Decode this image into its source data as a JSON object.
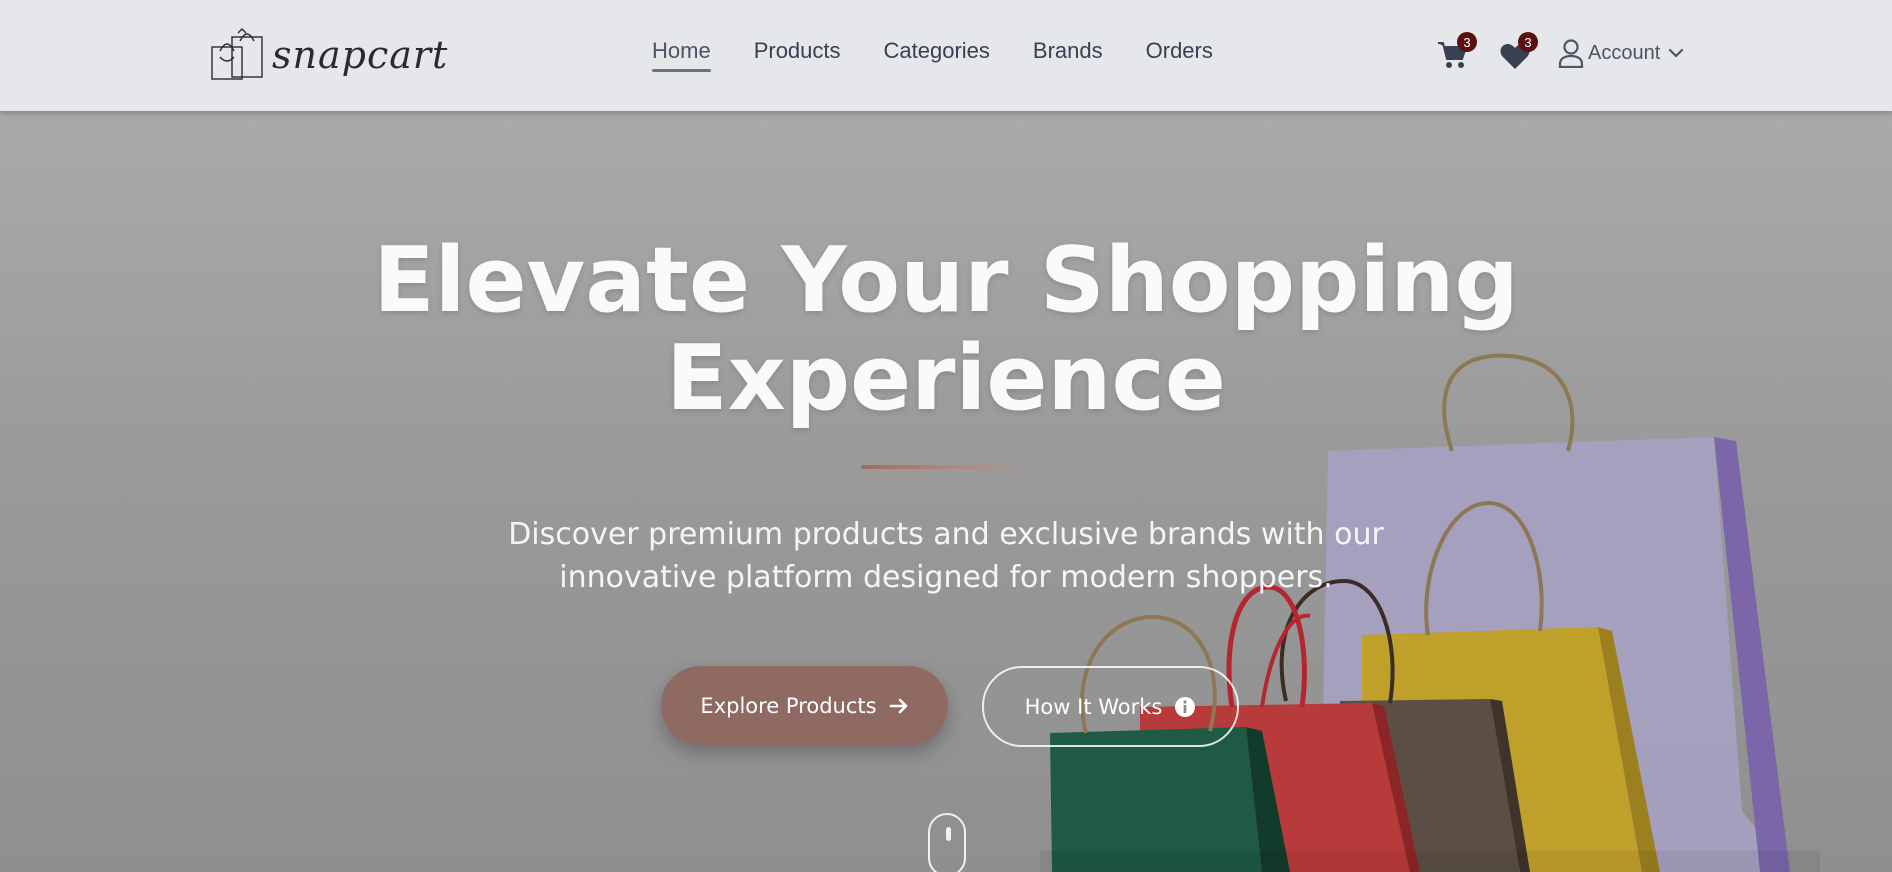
{
  "header": {
    "logo_text": "snapcart",
    "nav": [
      {
        "label": "Home",
        "active": true
      },
      {
        "label": "Products",
        "active": false
      },
      {
        "label": "Categories",
        "active": false
      },
      {
        "label": "Brands",
        "active": false
      },
      {
        "label": "Orders",
        "active": false
      }
    ],
    "cart_count": "3",
    "wishlist_count": "3",
    "account_label": "Account"
  },
  "hero": {
    "title_line1": "Elevate Your Shopping",
    "title_line2": "Experience",
    "subtitle_line1": "Discover premium products and exclusive brands with our",
    "subtitle_line2": "innovative platform designed for modern shoppers.",
    "primary_button": "Explore Products",
    "secondary_button": "How It Works"
  },
  "icons": {
    "logo": "shopping-bags-icon",
    "cart": "cart-icon",
    "wishlist": "heart-icon",
    "account": "user-icon",
    "dropdown": "chevron-down-icon",
    "primary_button": "arrow-right-icon",
    "secondary_button": "info-icon",
    "scroll": "scroll-mouse-icon"
  },
  "colors": {
    "header_bg": "#e5e7eb",
    "primary_button": "#8e6a63",
    "badge": "#5a1010"
  }
}
